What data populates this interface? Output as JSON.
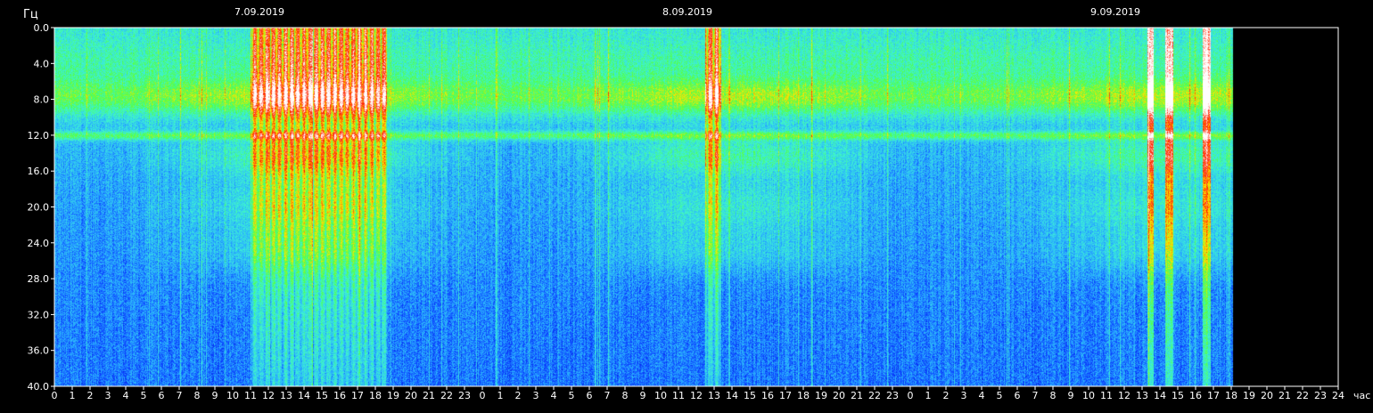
{
  "chart_data": {
    "type": "heatmap",
    "title": "",
    "ylabel": "Гц",
    "xlabel": "час",
    "ylim": [
      0,
      40
    ],
    "y_axis_inverted": true,
    "y_ticks": [
      "0.0",
      "4.0",
      "8.0",
      "12.0",
      "16.0",
      "20.0",
      "24.0",
      "28.0",
      "32.0",
      "36.0",
      "40.0"
    ],
    "x_ticks": [
      "0",
      "1",
      "2",
      "3",
      "4",
      "5",
      "6",
      "7",
      "8",
      "9",
      "10",
      "11",
      "12",
      "13",
      "14",
      "15",
      "16",
      "17",
      "18",
      "19",
      "20",
      "21",
      "22",
      "23",
      "0",
      "1",
      "2",
      "3",
      "4",
      "5",
      "6",
      "7",
      "8",
      "9",
      "10",
      "11",
      "12",
      "13",
      "14",
      "15",
      "16",
      "17",
      "18",
      "19",
      "20",
      "21",
      "22",
      "23",
      "0",
      "1",
      "2",
      "3",
      "4",
      "5",
      "6",
      "7",
      "8",
      "9",
      "10",
      "11",
      "12",
      "13",
      "14",
      "15",
      "16",
      "17",
      "18",
      "19",
      "20",
      "21",
      "22",
      "23",
      "24"
    ],
    "dates": [
      {
        "label": "7.09.2019",
        "hour": 11.5
      },
      {
        "label": "8.09.2019",
        "hour": 35.5
      },
      {
        "label": "9.09.2019",
        "hour": 59.5
      }
    ],
    "data_end_hour": 66.1,
    "resonance_bands_hz": [
      7.8,
      12.0,
      14.3,
      20.0,
      25.0
    ],
    "color_scale": [
      "#000d8a",
      "#0a3cff",
      "#2ab0ff",
      "#3df2d4",
      "#52ff4a",
      "#ffe600",
      "#ff2000",
      "#ffffff"
    ],
    "bright_events_hours": [
      {
        "start": 11.0,
        "end": 18.6,
        "note": "bursts"
      },
      {
        "start": 36.5,
        "end": 37.4,
        "note": "bursts"
      },
      {
        "start": 61.3,
        "end": 61.6,
        "note": "broadband line"
      },
      {
        "start": 62.3,
        "end": 62.7,
        "note": "broadband line"
      },
      {
        "start": 64.4,
        "end": 64.8,
        "note": "broadband line"
      }
    ]
  }
}
